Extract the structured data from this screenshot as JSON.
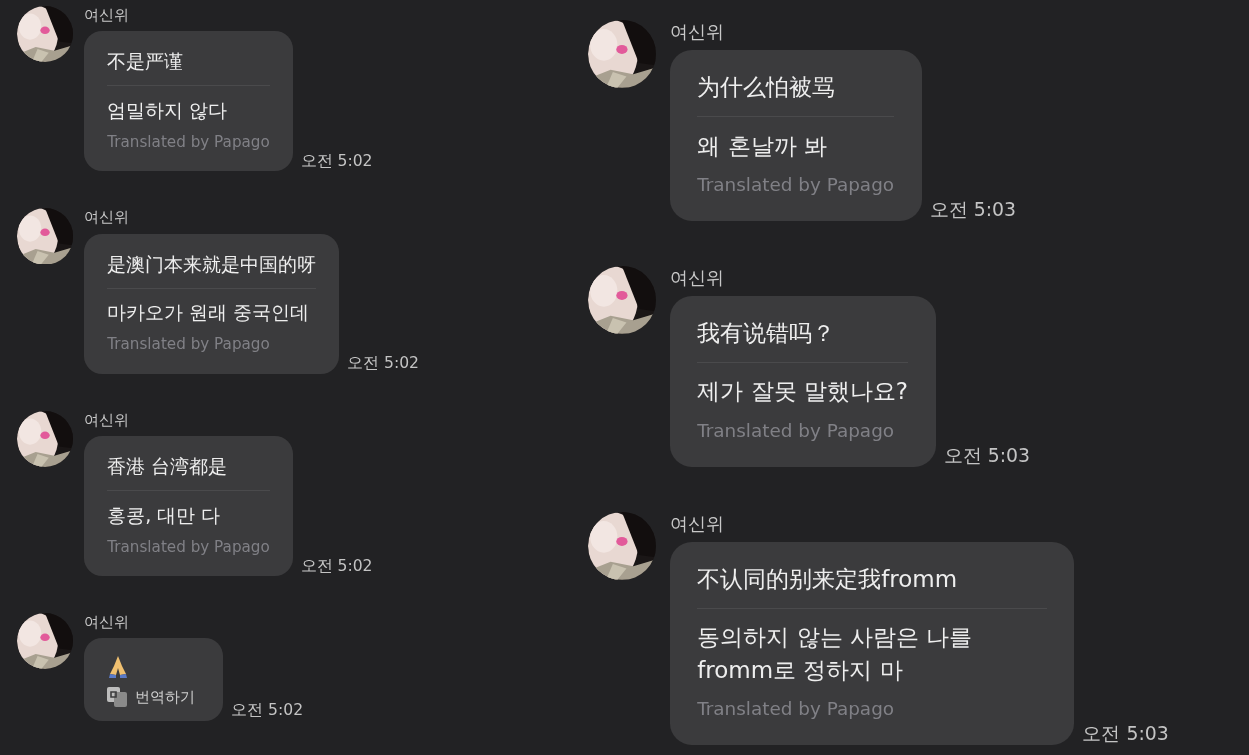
{
  "columns": [
    {
      "messages": [
        {
          "kind": "translated",
          "sender": "여신위",
          "original": "不是严谨",
          "translation": "엄밀하지 않다",
          "credit": "Translated by Papago",
          "time": "오전 5:02"
        },
        {
          "kind": "translated",
          "sender": "여신위",
          "original": "是澳门本来就是中国的呀",
          "translation": "마카오가 원래 중국인데",
          "credit": "Translated by Papago",
          "time": "오전 5:02"
        },
        {
          "kind": "translated",
          "sender": "여신위",
          "original": "香港 台湾都是",
          "translation": "홍콩, 대만 다",
          "credit": "Translated by Papago",
          "time": "오전 5:02"
        },
        {
          "kind": "emoji",
          "sender": "여신위",
          "action": "번역하기",
          "time": "오전 5:02"
        }
      ]
    },
    {
      "messages": [
        {
          "kind": "translated",
          "sender": "여신위",
          "original": "为什么怕被骂",
          "translation": "왜 혼날까 봐",
          "credit": "Translated by Papago",
          "time": "오전 5:03"
        },
        {
          "kind": "translated",
          "sender": "여신위",
          "original": "我有说错吗？",
          "translation": "제가 잘못 말했나요?",
          "credit": "Translated by Papago",
          "time": "오전 5:03"
        },
        {
          "kind": "translated",
          "sender": "여신위",
          "original": "不认同的别来定我fromm",
          "translation": "동의하지 않는 사람은 나를 fromm로 정하지 마",
          "credit": "Translated by Papago",
          "time": "오전 5:03"
        }
      ]
    }
  ]
}
